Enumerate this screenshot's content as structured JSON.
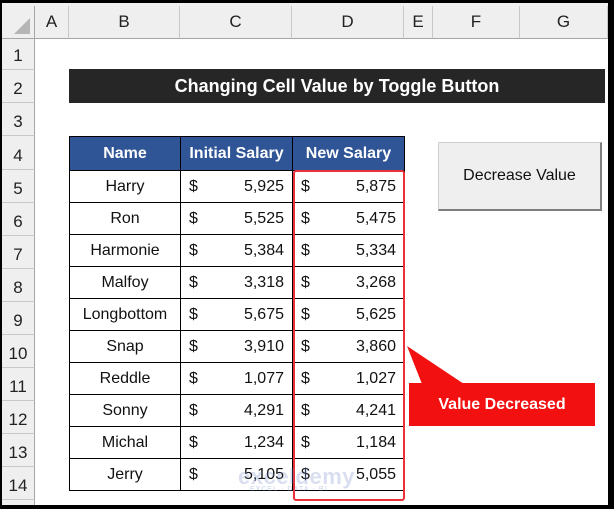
{
  "sheet": {
    "columns": [
      "A",
      "B",
      "C",
      "D",
      "E",
      "F",
      "G"
    ],
    "rows": [
      "1",
      "2",
      "3",
      "4",
      "5",
      "6",
      "7",
      "8",
      "9",
      "10",
      "11",
      "12",
      "13",
      "14"
    ]
  },
  "title": "Changing Cell Value by Toggle Button",
  "table": {
    "headers": [
      "Name",
      "Initial Salary",
      "New Salary"
    ],
    "currency_symbol": "$",
    "rows": [
      {
        "name": "Harry",
        "initial": "5,925",
        "new": "5,875"
      },
      {
        "name": "Ron",
        "initial": "5,525",
        "new": "5,475"
      },
      {
        "name": "Harmonie",
        "initial": "5,384",
        "new": "5,334"
      },
      {
        "name": "Malfoy",
        "initial": "3,318",
        "new": "3,268"
      },
      {
        "name": "Longbottom",
        "initial": "5,675",
        "new": "5,625"
      },
      {
        "name": "Snap",
        "initial": "3,910",
        "new": "3,860"
      },
      {
        "name": "Reddle",
        "initial": "1,077",
        "new": "1,027"
      },
      {
        "name": "Sonny",
        "initial": "4,291",
        "new": "4,241"
      },
      {
        "name": "Michal",
        "initial": "1,234",
        "new": "1,184"
      },
      {
        "name": "Jerry",
        "initial": "5,105",
        "new": "5,055"
      }
    ]
  },
  "toggle_button": {
    "label": "Decrease Value"
  },
  "callout": {
    "label": "Value Decreased",
    "color": "#f21010"
  },
  "highlight_color": "#e8323a",
  "header_color": "#2f5597",
  "watermark": {
    "brand": "exceldemy",
    "tagline": "EXCEL · DATA · BI"
  }
}
